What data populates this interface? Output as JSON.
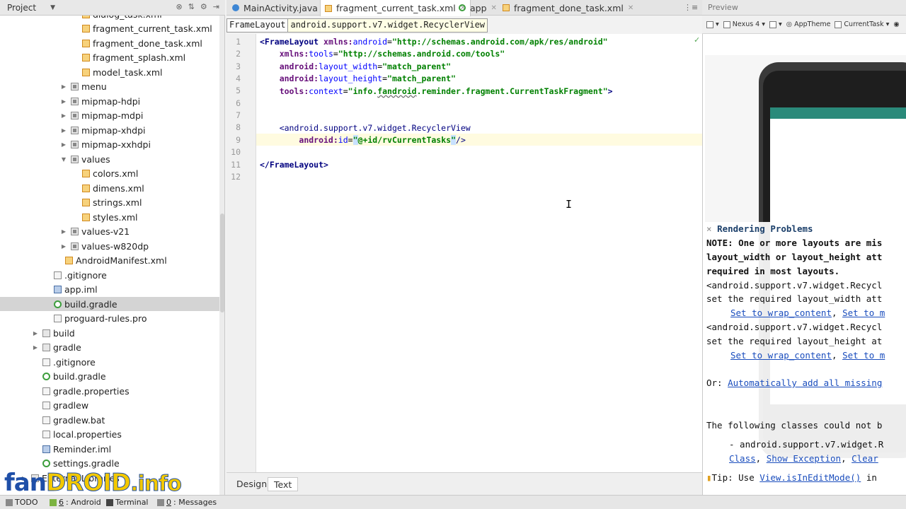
{
  "project_panel": {
    "title": "Project",
    "tree": [
      {
        "label": "dialog_task.xml",
        "icon": "xml",
        "depth": 2
      },
      {
        "label": "fragment_current_task.xml",
        "icon": "xml",
        "depth": 2
      },
      {
        "label": "fragment_done_task.xml",
        "icon": "xml",
        "depth": 2
      },
      {
        "label": "fragment_splash.xml",
        "icon": "xml",
        "depth": 2
      },
      {
        "label": "model_task.xml",
        "icon": "xml",
        "depth": 2
      },
      {
        "label": "menu",
        "icon": "res",
        "depth": 1,
        "expander": "collapsed"
      },
      {
        "label": "mipmap-hdpi",
        "icon": "res",
        "depth": 1,
        "expander": "collapsed"
      },
      {
        "label": "mipmap-mdpi",
        "icon": "res",
        "depth": 1,
        "expander": "collapsed"
      },
      {
        "label": "mipmap-xhdpi",
        "icon": "res",
        "depth": 1,
        "expander": "collapsed"
      },
      {
        "label": "mipmap-xxhdpi",
        "icon": "res",
        "depth": 1,
        "expander": "collapsed"
      },
      {
        "label": "values",
        "icon": "res",
        "depth": 1,
        "expander": "expanded"
      },
      {
        "label": "colors.xml",
        "icon": "xml",
        "depth": 2
      },
      {
        "label": "dimens.xml",
        "icon": "xml",
        "depth": 2
      },
      {
        "label": "strings.xml",
        "icon": "xml",
        "depth": 2
      },
      {
        "label": "styles.xml",
        "icon": "xml",
        "depth": 2
      },
      {
        "label": "values-v21",
        "icon": "res",
        "depth": 1,
        "expander": "collapsed"
      },
      {
        "label": "values-w820dp",
        "icon": "res",
        "depth": 1,
        "expander": "collapsed"
      },
      {
        "label": "AndroidManifest.xml",
        "icon": "xml",
        "depth": 0.5
      },
      {
        "label": ".gitignore",
        "icon": "file",
        "depth": -0.5
      },
      {
        "label": "app.iml",
        "icon": "iml",
        "depth": -0.5
      },
      {
        "label": "build.gradle",
        "icon": "gradle",
        "depth": -0.5,
        "selected": true
      },
      {
        "label": "proguard-rules.pro",
        "icon": "file",
        "depth": -0.5
      },
      {
        "label": "build",
        "icon": "folder",
        "depth": -1.5,
        "expander": "collapsed"
      },
      {
        "label": "gradle",
        "icon": "folder",
        "depth": -1.5,
        "expander": "collapsed"
      },
      {
        "label": ".gitignore",
        "icon": "file",
        "depth": -1.5
      },
      {
        "label": "build.gradle",
        "icon": "gradle",
        "depth": -1.5
      },
      {
        "label": "gradle.properties",
        "icon": "file",
        "depth": -1.5
      },
      {
        "label": "gradlew",
        "icon": "file",
        "depth": -1.5
      },
      {
        "label": "gradlew.bat",
        "icon": "file",
        "depth": -1.5
      },
      {
        "label": "local.properties",
        "icon": "file",
        "depth": -1.5
      },
      {
        "label": "Reminder.iml",
        "icon": "iml",
        "depth": -1.5
      },
      {
        "label": "settings.gradle",
        "icon": "gradle",
        "depth": -1.5
      },
      {
        "label": "External Libraries",
        "icon": "folder",
        "depth": -2.5,
        "expander": "collapsed"
      }
    ]
  },
  "watermark": {
    "part1": "fan",
    "part2": "DROID",
    "part3": ".info"
  },
  "tabs": [
    {
      "label": "MainActivity.java",
      "icon": "java"
    },
    {
      "label": "fragment_current_task.xml",
      "icon": "xml",
      "active": true
    },
    {
      "label": "app",
      "icon": "gradle"
    },
    {
      "label": "fragment_done_task.xml",
      "icon": "xml"
    }
  ],
  "breadcrumb": [
    "FrameLayout",
    "android.support.v7.widget.RecyclerView"
  ],
  "editor": {
    "line_numbers": [
      "1",
      "2",
      "3",
      "4",
      "5",
      "6",
      "7",
      "8",
      "9",
      "10",
      "11",
      "12"
    ]
  },
  "design_tabs": {
    "design": "Design",
    "text": "Text"
  },
  "preview": {
    "title": "Preview",
    "device": "Nexus 4",
    "theme": "AppTheme",
    "activity": "CurrentTask",
    "rendering": {
      "title": "Rendering Problems",
      "lines": [
        "NOTE: One or more layouts are mis",
        "layout_width or layout_height att",
        "required in most layouts.",
        "<android.support.v7.widget.Recycl",
        "set the required layout_width att",
        "<android.support.v7.widget.Recycl",
        "set the required layout_height at"
      ],
      "link_wrap": "Set to wrap_content",
      "link_match": "Set to m",
      "or_label": "Or:",
      "link_auto": "Automatically add all missing",
      "classes_line": "The following classes could not b",
      "class_item": "- android.support.v7.widget.R",
      "link_class": "Class",
      "link_show_exception": "Show Exception",
      "link_clear": "Clear",
      "tip_label": "Tip: Use",
      "link_tip": "View.isInEditMode()",
      "tip_tail": "in"
    }
  },
  "status_bar": {
    "todo": "TODO",
    "android_num": "6",
    "android": ": Android",
    "terminal": "Terminal",
    "messages_num": "0",
    "messages": ": Messages"
  },
  "colors": {
    "accent": "#1a4dbd",
    "selected_row": "#d4d4d4",
    "phone_bar": "#2a8a7a"
  }
}
